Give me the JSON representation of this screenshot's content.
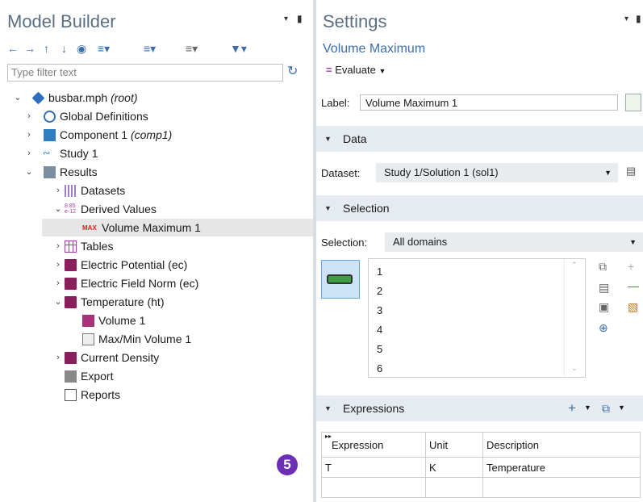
{
  "model_builder": {
    "title": "Model Builder",
    "filter_placeholder": "Type filter text",
    "tree": [
      {
        "label": "busbar.mph",
        "suffix": "(root)",
        "expanded": true
      },
      {
        "label": "Global Definitions",
        "expanded": false
      },
      {
        "label": "Component 1",
        "suffix": "(comp1)",
        "expanded": false
      },
      {
        "label": "Study 1",
        "expanded": false
      },
      {
        "label": "Results",
        "expanded": true
      },
      {
        "label": "Datasets",
        "expanded": false
      },
      {
        "label": "Derived Values",
        "expanded": true
      },
      {
        "label": "Volume Maximum 1",
        "selected": true
      },
      {
        "label": "Tables",
        "expanded": false
      },
      {
        "label": "Electric Potential (ec)",
        "expanded": false
      },
      {
        "label": "Electric Field Norm (ec)",
        "expanded": false
      },
      {
        "label": "Temperature (ht)",
        "expanded": true
      },
      {
        "label": "Volume 1"
      },
      {
        "label": "Max/Min Volume 1"
      },
      {
        "label": "Current Density",
        "expanded": false
      },
      {
        "label": "Export"
      },
      {
        "label": "Reports"
      }
    ],
    "badge": "5"
  },
  "settings": {
    "title": "Settings",
    "subtitle": "Volume Maximum",
    "evaluate_label": "Evaluate",
    "label_field_label": "Label:",
    "label_value": "Volume Maximum 1",
    "data_section": "Data",
    "dataset_label": "Dataset:",
    "dataset_value": "Study 1/Solution 1 (sol1)",
    "selection_section": "Selection",
    "selection_label": "Selection:",
    "selection_value": "All domains",
    "domains": [
      "1",
      "2",
      "3",
      "4",
      "5",
      "6"
    ],
    "expressions_section": "Expressions",
    "table": {
      "headers": [
        "Expression",
        "Unit",
        "Description"
      ],
      "rows": [
        [
          "T",
          "K",
          "Temperature"
        ],
        [
          "",
          "",
          ""
        ]
      ]
    }
  },
  "colors": {
    "section_bar": "#e5ebf1",
    "title_gray": "#5c6f80",
    "accent_blue": "#3c6ea8",
    "badge_purple": "#6a2fb5"
  }
}
